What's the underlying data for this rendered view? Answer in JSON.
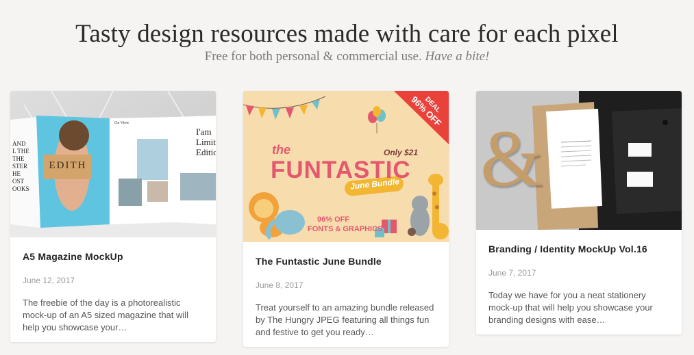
{
  "hero": {
    "title": "Tasty design resources made with care for each pixel",
    "subtitle_plain": "Free for both personal & commercial use.",
    "subtitle_em": "Have a bite!"
  },
  "cards": [
    {
      "title": "A5 Magazine MockUp",
      "date": "June 12, 2017",
      "desc": "The freebie of the day is a photorealistic mock-up of an A5 sized magazine that will help you showcase your…",
      "image": {
        "cover_word": "EDITH",
        "left_page_lines": [
          "AND",
          "L THE",
          "THE",
          "STER",
          "HE",
          "OST",
          "OOKS"
        ],
        "right_page_text": [
          "I'am",
          "Limite",
          "Editio"
        ],
        "small_heading": "On View"
      }
    },
    {
      "title": "The Funtastic June Bundle",
      "date": "June 8, 2017",
      "desc": "Treat yourself to an amazing bundle released by The Hungry JPEG featuring all things fun and festive to get you ready…",
      "image": {
        "ribbon_line1": "DEAL",
        "ribbon_line2": "96% OFF",
        "the": "the",
        "price": "Only $21",
        "word": "FUNTASTIC",
        "tag": "June Bundle",
        "off_line": "96% OFF",
        "fonts_line": "FONTS & GRAPHICS"
      }
    },
    {
      "title": "Branding / Identity MockUp Vol.16",
      "date": "June 7, 2017",
      "desc": "Today we have for you a neat stationery mock-up that will help you showcase your branding designs with ease…",
      "image": {
        "ampersand": "&"
      }
    }
  ],
  "colors": {
    "background": "#f5f4f2",
    "funtastic_bg": "#f7dcae",
    "funtastic_pink": "#e4586e",
    "ribbon_red": "#e9423b",
    "magazine_blue": "#5ec4df",
    "branding_dark": "#1e1e1e",
    "kraft": "#c9a57a"
  }
}
